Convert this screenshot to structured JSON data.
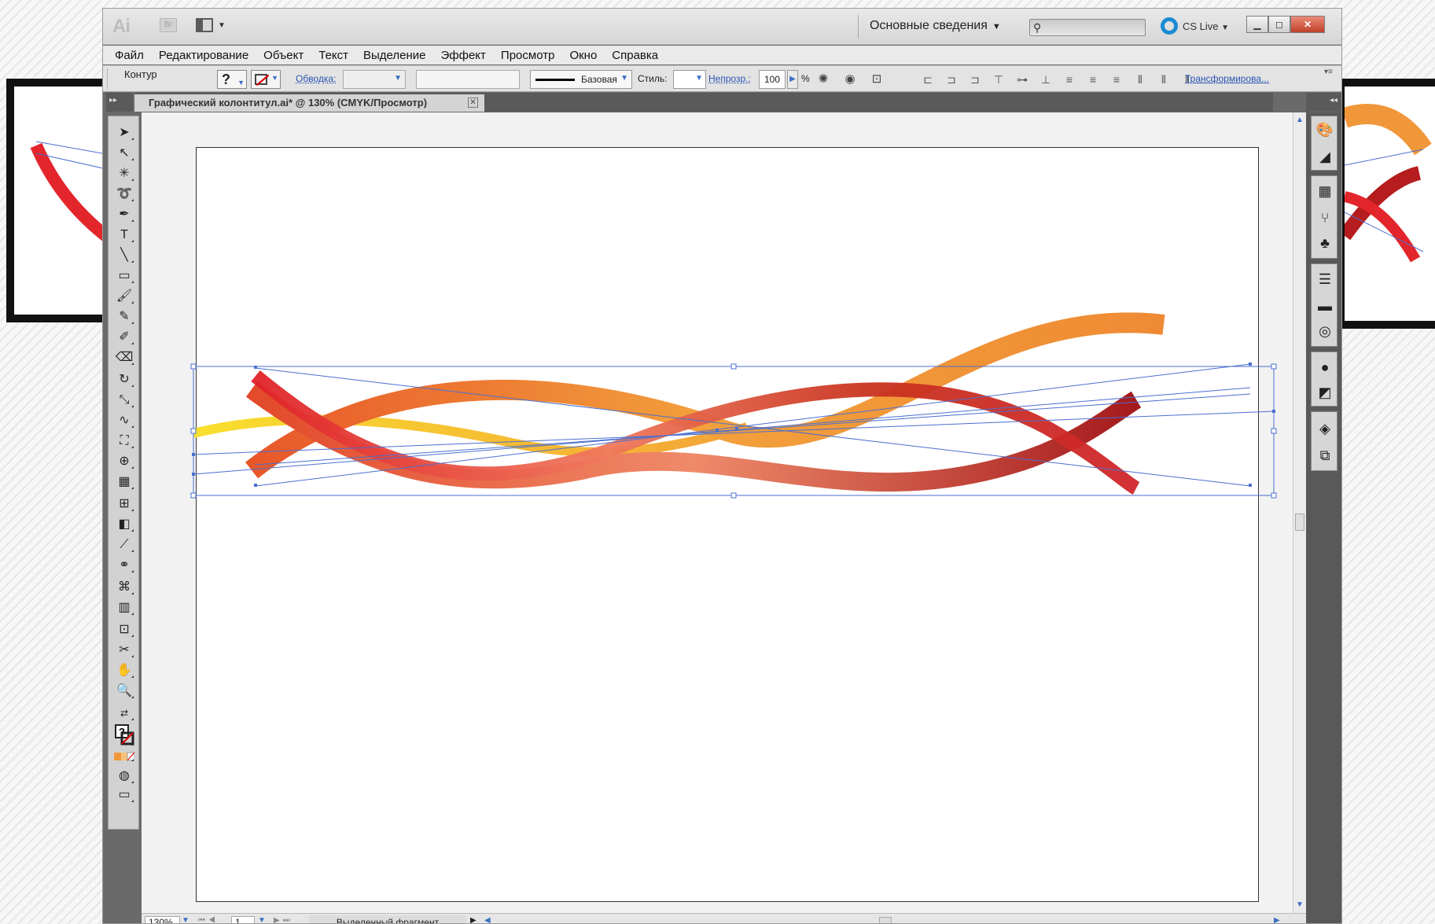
{
  "app": {
    "logo": "Ai",
    "bridge_logo": "Br",
    "workspace": "Основные сведения",
    "search_placeholder": "",
    "cs_live": "CS Live"
  },
  "menu": [
    "Файл",
    "Редактирование",
    "Объект",
    "Текст",
    "Выделение",
    "Эффект",
    "Просмотр",
    "Окно",
    "Справка"
  ],
  "control": {
    "object_type": "Контур",
    "fill_symbol": "?",
    "stroke_label": "Обводка:",
    "brush_label": "Базовая",
    "style_label": "Стиль:",
    "opacity_label": "Непрозр.:",
    "opacity_value": "100",
    "percent": "%",
    "transform_link": "Трансформирова..."
  },
  "document": {
    "tab_title": "Графический колонтитул.ai* @ 130% (CMYK/Просмотр)"
  },
  "tools": [
    "selection-tool",
    "direct-selection-tool",
    "magic-wand-tool",
    "lasso-tool",
    "pen-tool",
    "type-tool",
    "line-tool",
    "rectangle-tool",
    "paintbrush-tool",
    "pencil-tool",
    "blob-brush-tool",
    "eraser-tool",
    "rotate-tool",
    "scale-tool",
    "warp-tool",
    "free-transform-tool",
    "shape-builder-tool",
    "perspective-grid-tool",
    "mesh-tool",
    "gradient-tool",
    "eyedropper-tool",
    "blend-tool",
    "symbol-sprayer-tool",
    "column-graph-tool",
    "artboard-tool",
    "slice-tool",
    "hand-tool",
    "zoom-tool"
  ],
  "status": {
    "zoom": "130%",
    "page": "1",
    "selection": "Выделенный фрагмент"
  },
  "colors": {
    "accent_blue": "#3b6fc2",
    "ribbon_red": "#d9232b",
    "ribbon_orange": "#f0973a",
    "ribbon_yellow": "#f7d02c"
  }
}
